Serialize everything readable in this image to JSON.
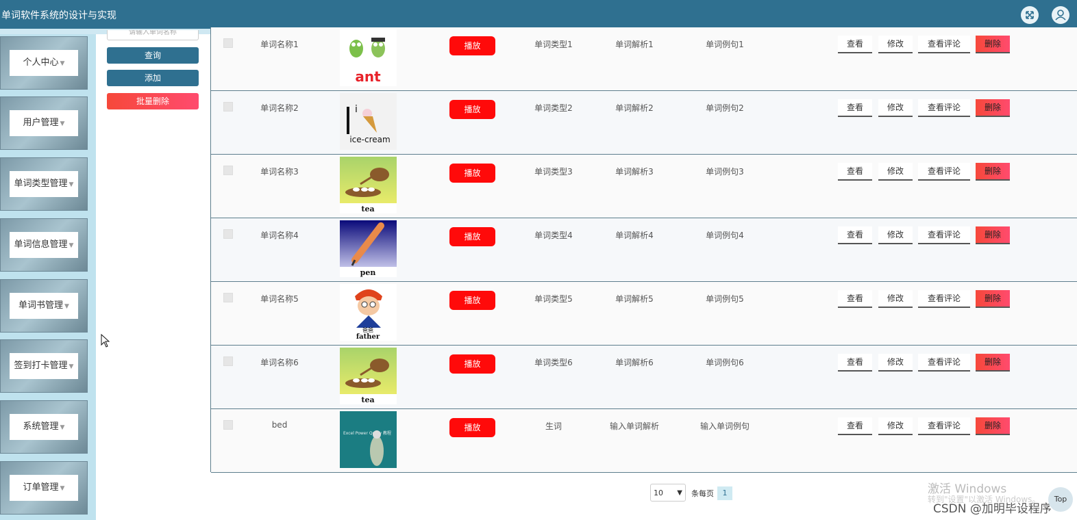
{
  "header": {
    "title": "单词软件系统的设计与实现",
    "fullscreen_icon": "fullscreen-icon",
    "user_icon": "user-icon"
  },
  "sidebar": {
    "items": [
      {
        "label": "个人中心"
      },
      {
        "label": "用户管理"
      },
      {
        "label": "单词类型管理"
      },
      {
        "label": "单词信息管理"
      },
      {
        "label": "单词书管理"
      },
      {
        "label": "签到打卡管理"
      },
      {
        "label": "系统管理"
      },
      {
        "label": "订单管理"
      }
    ]
  },
  "tools": {
    "search_placeholder": "请输入单词名称",
    "query_label": "查询",
    "add_label": "添加",
    "batch_delete_label": "批量删除"
  },
  "rows": [
    {
      "name": "单词名称1",
      "image": "ant",
      "play": "播放",
      "type": "单词类型1",
      "analysis": "单词解析1",
      "example": "单词例句1"
    },
    {
      "name": "单词名称2",
      "image": "ice-cream",
      "play": "播放",
      "type": "单词类型2",
      "analysis": "单词解析2",
      "example": "单词例句2"
    },
    {
      "name": "单词名称3",
      "image": "tea",
      "play": "播放",
      "type": "单词类型3",
      "analysis": "单词解析3",
      "example": "单词例句3"
    },
    {
      "name": "单词名称4",
      "image": "pen",
      "play": "播放",
      "type": "单词类型4",
      "analysis": "单词解析4",
      "example": "单词例句4"
    },
    {
      "name": "单词名称5",
      "image": "father",
      "image_text": "爸爸",
      "play": "播放",
      "type": "单词类型5",
      "analysis": "单词解析5",
      "example": "单词例句5"
    },
    {
      "name": "单词名称6",
      "image": "tea",
      "play": "播放",
      "type": "单词类型6",
      "analysis": "单词解析6",
      "example": "单词例句6"
    },
    {
      "name": "bed",
      "image": "Excel Power Query 教程",
      "play": "播放",
      "type": "生词",
      "analysis": "输入单词解析",
      "example": "输入单词例句"
    }
  ],
  "actions": {
    "view": "查看",
    "edit": "修改",
    "comments": "查看评论",
    "delete": "删除"
  },
  "pagination": {
    "page_size": "10",
    "per_page_label": "条每页",
    "current_page": "1"
  },
  "watermark": {
    "line1": "激活 Windows",
    "line2": "转到\"设置\"以激活 Windows。",
    "csdn": "CSDN @加明毕设程序"
  },
  "top_button": "Top"
}
